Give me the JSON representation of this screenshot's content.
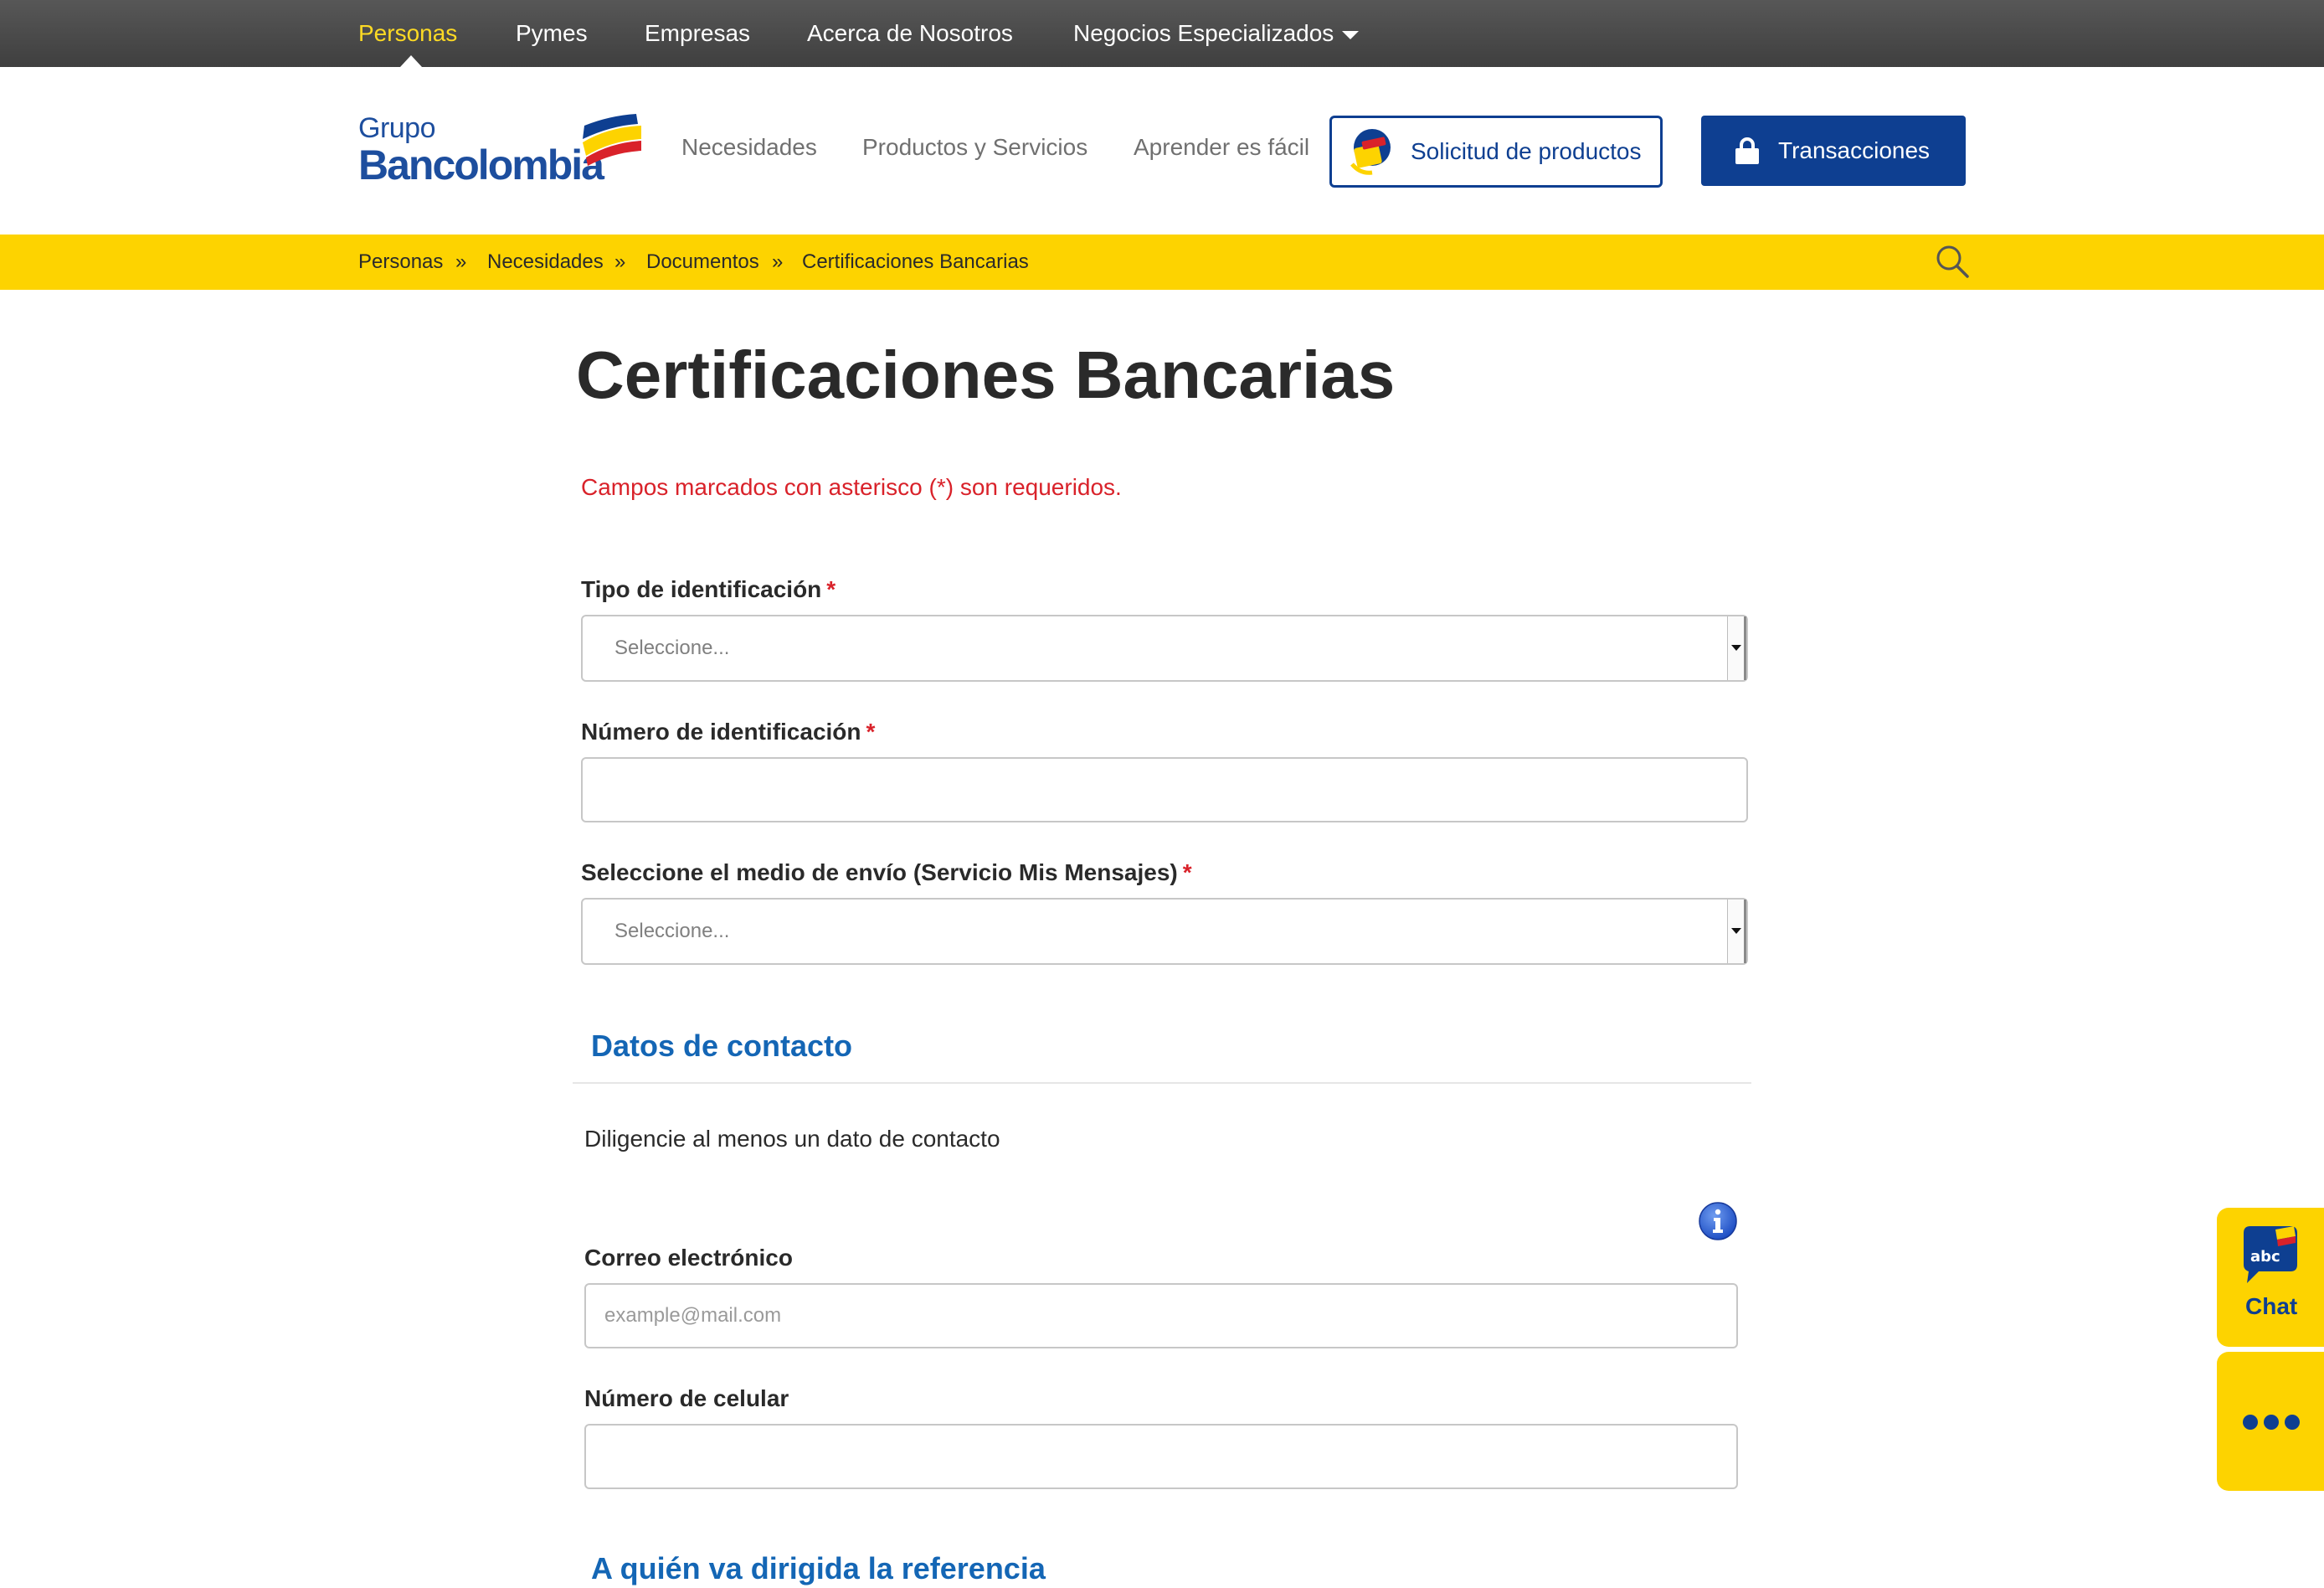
{
  "topnav": {
    "items": [
      {
        "label": "Personas",
        "active": true
      },
      {
        "label": "Pymes"
      },
      {
        "label": "Empresas"
      },
      {
        "label": "Acerca de Nosotros"
      },
      {
        "label": "Negocios Especializados"
      }
    ]
  },
  "header": {
    "logo": {
      "line1": "Grupo",
      "line2": "Bancolombia"
    },
    "nav": [
      "Necesidades",
      "Productos y Servicios",
      "Aprender es fácil"
    ],
    "solicitud_label": "Solicitud de productos",
    "transacciones_label": "Transacciones"
  },
  "breadcrumb": {
    "items": [
      "Personas",
      "Necesidades",
      "Documentos",
      "Certificaciones Bancarias"
    ],
    "separator": "»"
  },
  "page": {
    "title": "Certificaciones Bancarias",
    "required_note": "Campos marcados con asterisco (*) son requeridos."
  },
  "form": {
    "tipo_id": {
      "label": "Tipo de identificación",
      "required_mark": "*",
      "placeholder": "Seleccione..."
    },
    "numero_id": {
      "label": "Número de identificación",
      "required_mark": "*",
      "value": ""
    },
    "medio_envio": {
      "label": "Seleccione el medio de envío (Servicio Mis Mensajes)",
      "required_mark": "*",
      "placeholder": "Seleccione..."
    }
  },
  "contacto": {
    "title": "Datos de contacto",
    "hint": "Diligencie al menos un dato de contacto",
    "email": {
      "label": "Correo electrónico",
      "placeholder": "example@mail.com"
    },
    "celular": {
      "label": "Número de celular",
      "value": ""
    }
  },
  "referencia": {
    "title": "A quién va dirigida la referencia"
  },
  "widgets": {
    "chat_label": "Chat",
    "chat_badge": "abc"
  },
  "colors": {
    "brand_blue": "#0e3f91",
    "link_blue": "#1466b5",
    "brand_yellow": "#fdd300",
    "required_red": "#d9222a",
    "topnav_bg": "#4a4a4a"
  },
  "icons": [
    "caret-down-icon",
    "bancolombia-logo-flag",
    "solicitud-icon",
    "lock-icon",
    "search-icon",
    "info-icon",
    "chat-icon",
    "more-icon"
  ]
}
